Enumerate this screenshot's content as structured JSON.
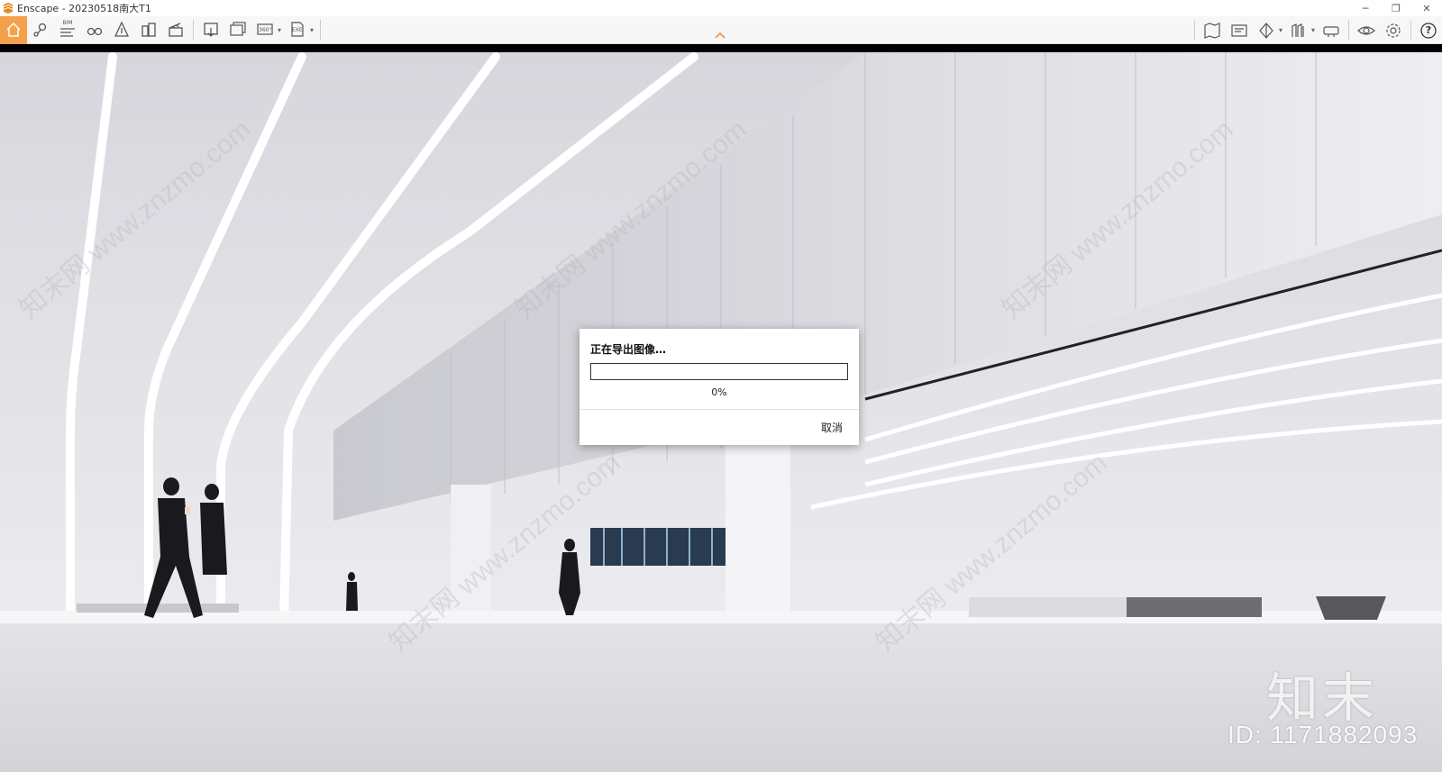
{
  "window": {
    "title": "Enscape - 20230518南大T1",
    "minimize": "─",
    "restore": "❐",
    "close": "✕"
  },
  "toolbar": {
    "left_icons": [
      "home-icon",
      "location-icon",
      "bim-icon",
      "binoculars-icon",
      "navigation-icon",
      "buildings-icon",
      "clapper-icon"
    ],
    "bim_label": "BIM",
    "export_icons": [
      "screenshot-export-icon",
      "batch-export-icon",
      "panorama-export-icon",
      "exe-export-icon"
    ],
    "panorama_label": "360°",
    "exe_label": "EXE",
    "right_icons": [
      "map-icon",
      "asset-library-icon",
      "view-mode-icon",
      "material-icon",
      "vr-icon",
      "visibility-icon",
      "settings-icon",
      "help-icon"
    ],
    "help_label": "?",
    "accent_color": "#f5a04c"
  },
  "dialog": {
    "title": "正在导出图像…",
    "progress_fraction": 0.0,
    "percent_text": "0%",
    "cancel_label": "取消"
  },
  "watermark": {
    "brand": "知末",
    "id_text": "ID: 1171882093",
    "diagonal_text": "知末网 www.znzmo.com"
  }
}
